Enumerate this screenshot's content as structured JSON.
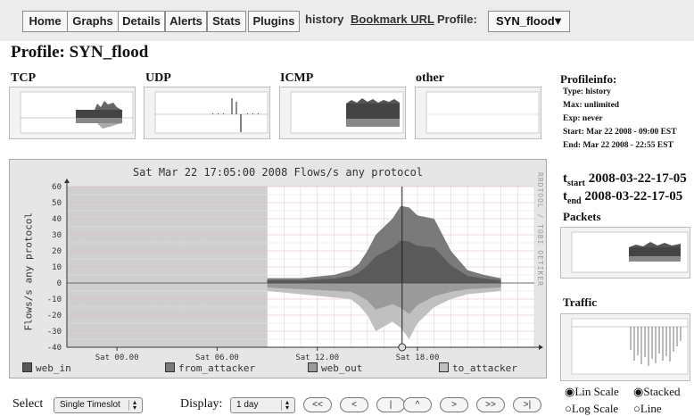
{
  "nav": {
    "buttons": [
      "Home",
      "Graphs",
      "Details",
      "Alerts",
      "Stats",
      "Plugins"
    ],
    "history_label": "history",
    "bookmark_label": "Bookmark URL",
    "profile_label": "Profile:",
    "profile_value": "SYN_flood",
    "profile_arrow": "▼"
  },
  "page_title": "Profile: SYN_flood",
  "panels": [
    {
      "label": "TCP"
    },
    {
      "label": "UDP"
    },
    {
      "label": "ICMP"
    },
    {
      "label": "other"
    }
  ],
  "profileinfo": {
    "title": "Profileinfo:",
    "rows": [
      "Type: history",
      "Max: unlimited",
      "Exp: never",
      "Start: Mar 22 2008 - 09:00 EST",
      "End: Mar 22 2008 - 22:55 EST"
    ],
    "t_start_label": "start",
    "t_start_value": "2008-03-22-17-05",
    "t_end_label": "end",
    "t_end_value": "2008-03-22-17-05",
    "packets_label": "Packets",
    "traffic_label": "Traffic"
  },
  "main_graph": {
    "title": "Sat Mar 22 17:05:00 2008 Flows/s any protocol",
    "side_text": "RRDTOOL / TOBI OETIKER"
  },
  "chart_data": {
    "type": "area",
    "title": "Sat Mar 22 17:05:00 2008 Flows/s any protocol",
    "ylabel": "Flows/s any protocol",
    "ylim": [
      -40,
      60
    ],
    "yticks": [
      "60",
      "50",
      "40",
      "30",
      "20",
      "10",
      "0",
      "-10",
      "-20",
      "-30",
      "-40"
    ],
    "x_ticks": [
      "Sat 00.00",
      "Sat 06.00",
      "Sat 12.00",
      "Sat 18.00"
    ],
    "x_hours": [
      -3,
      25
    ],
    "marker_hour": 17.08,
    "shaded_until_hour": 9,
    "stacked": true,
    "series": [
      {
        "name": "web_in",
        "color": "#5a5a5a",
        "direction": "up"
      },
      {
        "name": "from_attacker",
        "color": "#7a7a7a",
        "direction": "up"
      },
      {
        "name": "web_out",
        "color": "#9a9a9a",
        "direction": "down"
      },
      {
        "name": "to_attacker",
        "color": "#c0c0c0",
        "direction": "down"
      }
    ],
    "hours": [
      9,
      10,
      11,
      12,
      13,
      14,
      14.5,
      15,
      15.5,
      16,
      16.5,
      17,
      17.5,
      18,
      19,
      20,
      21,
      22,
      23
    ],
    "positive_totals": [
      3,
      3,
      3,
      4,
      5,
      8,
      12,
      20,
      30,
      35,
      40,
      48,
      47,
      42,
      40,
      20,
      8,
      5,
      3
    ],
    "negative_totals": [
      -5,
      -6,
      -7,
      -8,
      -9,
      -10,
      -14,
      -20,
      -30,
      -27,
      -24,
      -28,
      -35,
      -25,
      -15,
      -10,
      -7,
      -6,
      -5
    ]
  },
  "controls": {
    "select_label": "Select",
    "select_value": "Single Timeslot",
    "display_label": "Display:",
    "display_value": "1 day",
    "nav_buttons": [
      "<<",
      "<",
      "|",
      "^",
      ">",
      ">>",
      ">|"
    ],
    "scale_options": [
      "Lin Scale",
      "Log Scale"
    ],
    "mode_options": [
      "Stacked",
      "Line"
    ]
  }
}
